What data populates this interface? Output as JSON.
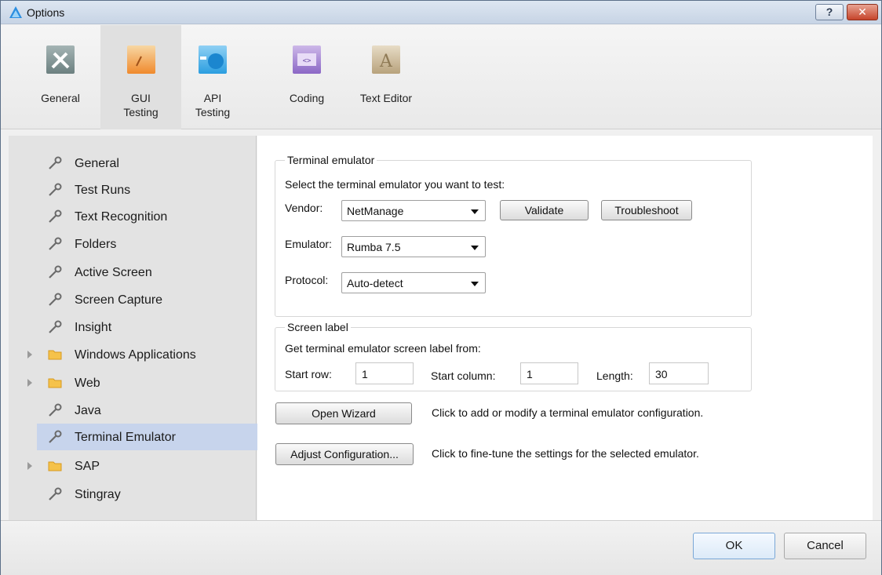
{
  "window": {
    "title": "Options",
    "help_glyph": "?",
    "close_glyph": "✕"
  },
  "toolbar": {
    "items": [
      {
        "label": "General",
        "icon": "tools-icon"
      },
      {
        "label": "GUI\nTesting",
        "icon": "gui-testing-icon",
        "selected": true
      },
      {
        "label": "API\nTesting",
        "icon": "api-testing-icon"
      },
      {
        "label": "Coding",
        "icon": "coding-icon"
      },
      {
        "label": "Text Editor",
        "icon": "text-editor-icon"
      }
    ]
  },
  "nav": {
    "items": [
      {
        "label": "General",
        "icon": "wrench-icon"
      },
      {
        "label": "Test Runs",
        "icon": "wrench-icon"
      },
      {
        "label": "Text Recognition",
        "icon": "wrench-icon"
      },
      {
        "label": "Folders",
        "icon": "wrench-icon"
      },
      {
        "label": "Active Screen",
        "icon": "wrench-icon"
      },
      {
        "label": "Screen Capture",
        "icon": "wrench-icon"
      },
      {
        "label": "Insight",
        "icon": "wrench-icon"
      },
      {
        "label": "Windows Applications",
        "icon": "folder-icon",
        "expandable": true
      },
      {
        "label": "Web",
        "icon": "folder-icon",
        "expandable": true
      },
      {
        "label": "Java",
        "icon": "wrench-icon"
      },
      {
        "label": "Terminal Emulator",
        "icon": "wrench-icon",
        "selected": true
      },
      {
        "label": "SAP",
        "icon": "folder-icon",
        "expandable": true
      },
      {
        "label": "Stingray",
        "icon": "wrench-icon"
      }
    ]
  },
  "terminal": {
    "group_title": "Terminal emulator",
    "instruction": "Select the terminal emulator you want to test:",
    "vendor_label": "Vendor:",
    "vendor_value": "NetManage",
    "validate_label": "Validate",
    "troubleshoot_label": "Troubleshoot",
    "emulator_label": "Emulator:",
    "emulator_value": "Rumba 7.5",
    "protocol_label": "Protocol:",
    "protocol_value": "Auto-detect"
  },
  "screen_label": {
    "group_title": "Screen label",
    "instruction": "Get terminal emulator screen label from:",
    "start_row_label": "Start row:",
    "start_row_value": "1",
    "start_column_label": "Start column:",
    "start_column_value": "1",
    "length_label": "Length:",
    "length_value": "30"
  },
  "actions": {
    "open_wizard_label": "Open Wizard",
    "open_wizard_desc": "Click to add or modify a terminal emulator configuration.",
    "adjust_label": "Adjust Configuration...",
    "adjust_desc": "Click to fine-tune the settings for the selected emulator."
  },
  "footer": {
    "ok_label": "OK",
    "cancel_label": "Cancel"
  },
  "colors": {
    "selected_nav": "#c7d4ec",
    "ok_border": "#7aa7d6",
    "close_button": "#c6452b"
  }
}
